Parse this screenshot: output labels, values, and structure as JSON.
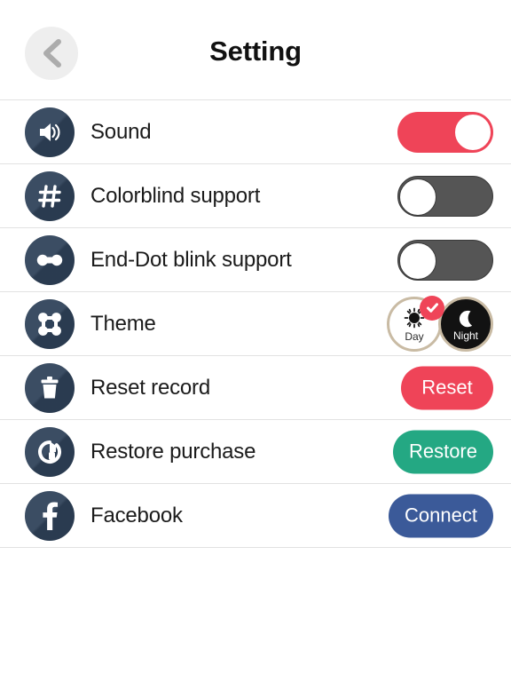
{
  "header": {
    "title": "Setting",
    "back_icon": "chevron-left-icon"
  },
  "colors": {
    "toggle_on": "#ef4458",
    "toggle_off": "#555555",
    "icon_bg": "#2f4259",
    "reset_button": "#ef4458",
    "restore_button": "#24a883",
    "connect_button": "#3b5a99",
    "theme_ring": "#c9bba4",
    "check_badge": "#ef4458"
  },
  "rows": [
    {
      "key": "sound",
      "label": "Sound",
      "icon": "speaker-sound-icon",
      "control": "toggle",
      "toggle_state": "on"
    },
    {
      "key": "colorblind",
      "label": "Colorblind support",
      "icon": "hash-icon",
      "control": "toggle",
      "toggle_state": "off"
    },
    {
      "key": "end-dot-blink",
      "label": "End-Dot blink support",
      "icon": "end-dot-icon",
      "control": "toggle",
      "toggle_state": "off"
    },
    {
      "key": "theme",
      "label": "Theme",
      "icon": "theme-nodes-icon",
      "control": "theme-picker"
    },
    {
      "key": "reset-record",
      "label": "Reset record",
      "icon": "trash-icon",
      "control": "button",
      "button_label": "Reset"
    },
    {
      "key": "restore-purchase",
      "label": "Restore purchase",
      "icon": "restore-circle-arrow-icon",
      "control": "button",
      "button_label": "Restore"
    },
    {
      "key": "facebook",
      "label": "Facebook",
      "icon": "facebook-f-icon",
      "control": "button",
      "button_label": "Connect"
    }
  ],
  "theme": {
    "options": [
      {
        "key": "day",
        "label": "Day",
        "icon": "sun-icon",
        "selected": true
      },
      {
        "key": "night",
        "label": "Night",
        "icon": "moon-icon",
        "selected": false
      }
    ],
    "check_icon": "check-icon"
  }
}
